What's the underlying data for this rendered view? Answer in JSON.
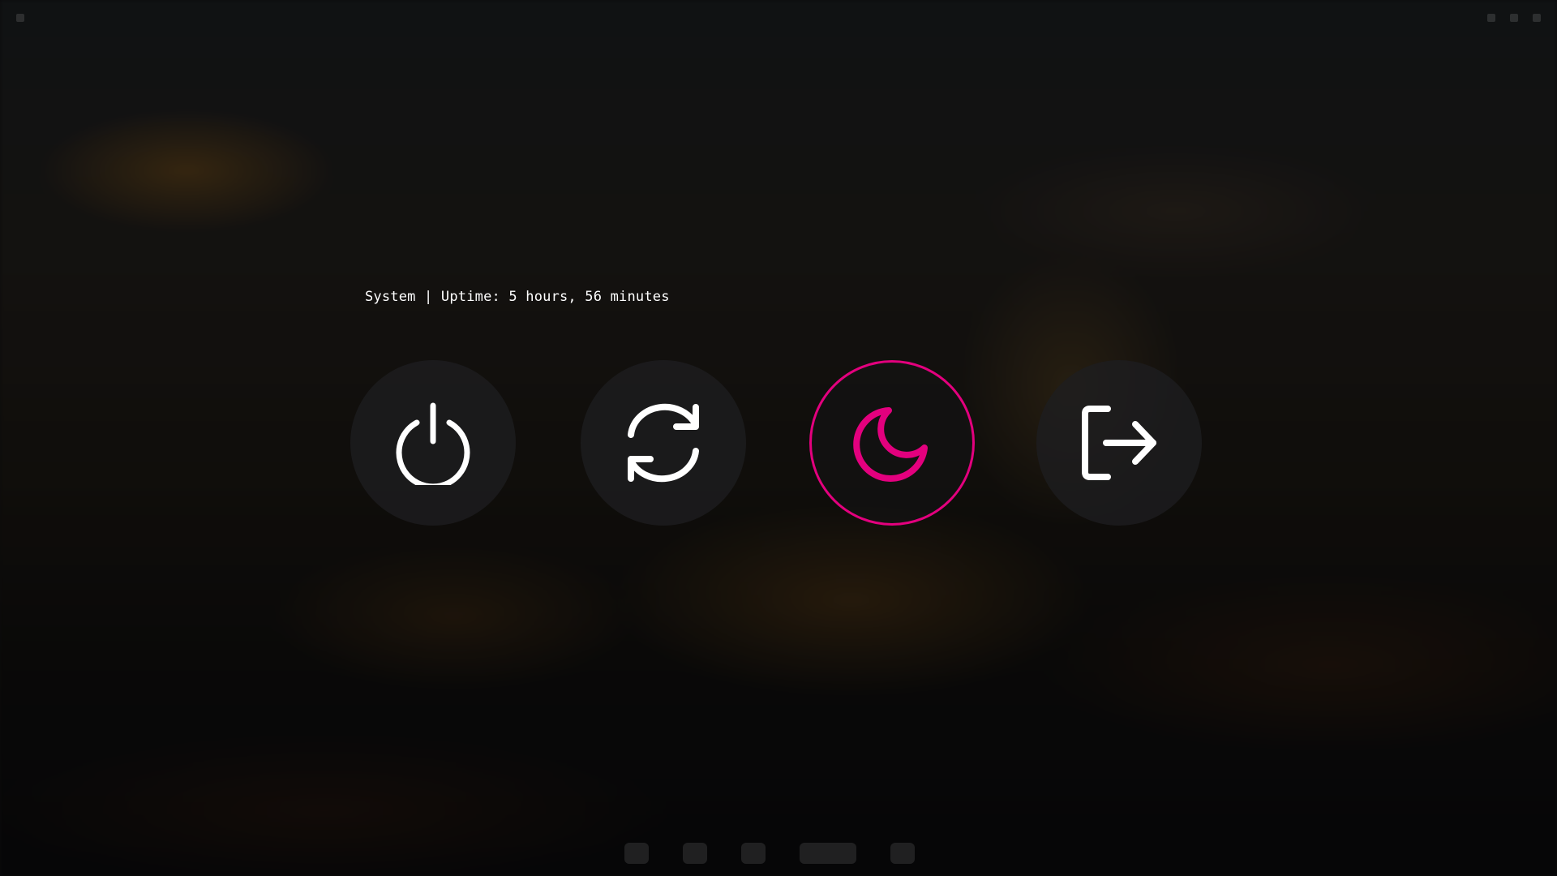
{
  "prompt": {
    "text": "System | Uptime: 5 hours, 56 minutes"
  },
  "options": [
    {
      "icon": "power-icon",
      "selected": false
    },
    {
      "icon": "reboot-icon",
      "selected": false
    },
    {
      "icon": "suspend-moon-icon",
      "selected": true
    },
    {
      "icon": "logout-icon",
      "selected": false
    }
  ],
  "colors": {
    "accent": "#e3007e",
    "icon_default": "#ffffff",
    "option_background": "#1e1e20"
  }
}
